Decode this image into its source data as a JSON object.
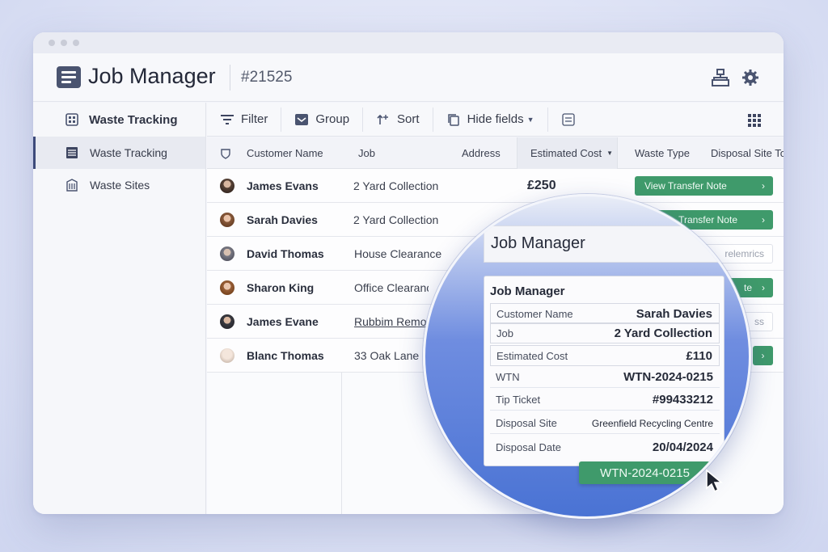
{
  "header": {
    "app_title": "Job Manager",
    "record_id": "#21525",
    "icons": [
      "hierarchy-icon",
      "gear-icon"
    ]
  },
  "sidebar": {
    "section_label": "Waste Tracking",
    "items": [
      {
        "label": "Waste Tracking",
        "icon": "table-icon",
        "active": true
      },
      {
        "label": "Waste Sites",
        "icon": "building-icon",
        "active": false
      }
    ]
  },
  "toolbar": {
    "filter": "Filter",
    "group": "Group",
    "sort": "Sort",
    "hide_fields": "Hide fields"
  },
  "table": {
    "columns": {
      "customer_name": "Customer Name",
      "job": "Job",
      "address": "Address",
      "estimated_cost": "Estimated Cost",
      "waste_type": "Waste Type",
      "disposal_site": "Disposal Site To"
    },
    "rows": [
      {
        "name": "James Evans",
        "job": "2 Yard Collection",
        "cost": "£250",
        "pill": "View Transfer Note"
      },
      {
        "name": "Sarah Davies",
        "job": "2 Yard Collection",
        "cost": "",
        "pill": "Transfer Note"
      },
      {
        "name": "David Thomas",
        "job": "House Clearance",
        "cost": "",
        "pill": "relemrics"
      },
      {
        "name": "Sharon King",
        "job": "Office Clearance",
        "cost": "",
        "pill": "te"
      },
      {
        "name": "James Evane",
        "job": "Rubbim Remo",
        "cost": "",
        "pill": "ss"
      },
      {
        "name": "Blanc Thomas",
        "job": "33 Oak Lane",
        "cost": "",
        "pill": ""
      }
    ]
  },
  "magnifier": {
    "header_title": "Job Manager",
    "card_title": "Job Manager",
    "fields": [
      {
        "label": "Customer Name",
        "value": "Sarah Davies"
      },
      {
        "label": "Job",
        "value": "2 Yard Collection"
      },
      {
        "label": "Estimated Cost",
        "value": "£110"
      },
      {
        "label": "WTN",
        "value": "WTN-2024-0215"
      },
      {
        "label": "Tip Ticket",
        "value": "#99433212"
      },
      {
        "label": "Disposal Site",
        "value": "Greenfield Recycling Centre"
      },
      {
        "label": "Disposal Date",
        "value": "20/04/2024"
      }
    ],
    "button_label": "WTN-2024-0215"
  },
  "colors": {
    "accent_green": "#3f9a6b",
    "brand_dark": "#4a5470",
    "magnifier_blue": "#4a73d4"
  }
}
